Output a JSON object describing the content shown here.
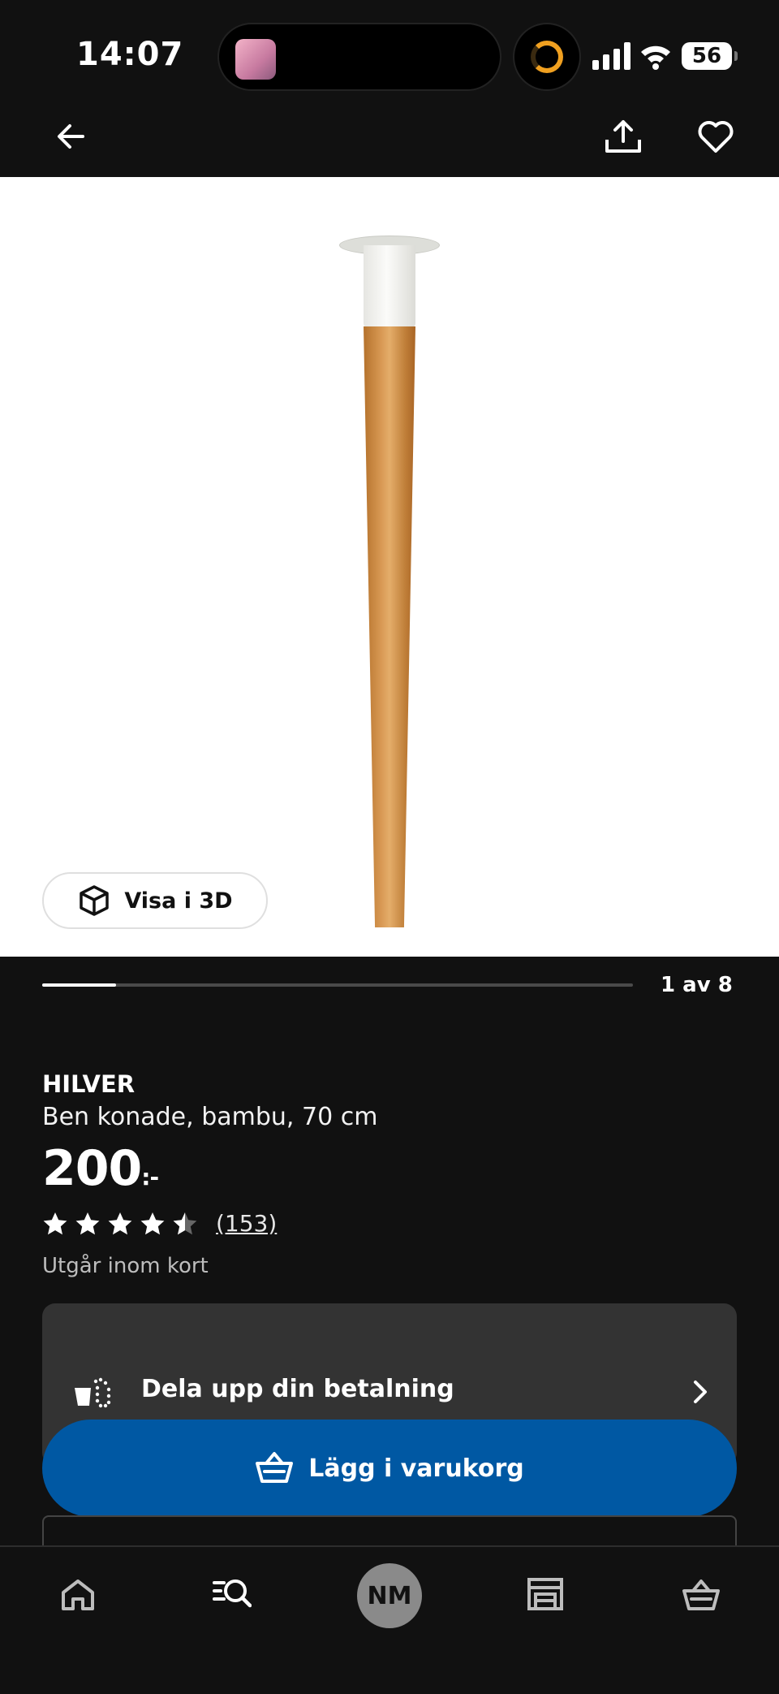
{
  "status_bar": {
    "time": "14:07",
    "battery": "56"
  },
  "header": {
    "back_icon": "arrow-left-icon",
    "share_icon": "share-icon",
    "favorite_icon": "heart-icon"
  },
  "gallery": {
    "view_3d_label": "Visa i 3D",
    "pager_label": "1 av 8",
    "current_image": 1,
    "total_images": 8
  },
  "product": {
    "name": "HILVER",
    "description": "Ben konade, bambu, 70 cm",
    "price": "200",
    "price_suffix": ":-",
    "rating": 4.5,
    "review_count": "(153)",
    "availability": "Utgår inom kort"
  },
  "payment": {
    "label": "Dela upp din betalning"
  },
  "cart": {
    "button_label": "Lägg i varukorg"
  },
  "tab_bar": {
    "items": [
      {
        "icon": "home-icon"
      },
      {
        "icon": "search-icon"
      },
      {
        "icon": "profile-avatar",
        "label": "NM"
      },
      {
        "icon": "store-icon"
      },
      {
        "icon": "cart-icon"
      }
    ]
  },
  "colors": {
    "background": "#111111",
    "accent": "#0058a3",
    "card": "#333333"
  }
}
